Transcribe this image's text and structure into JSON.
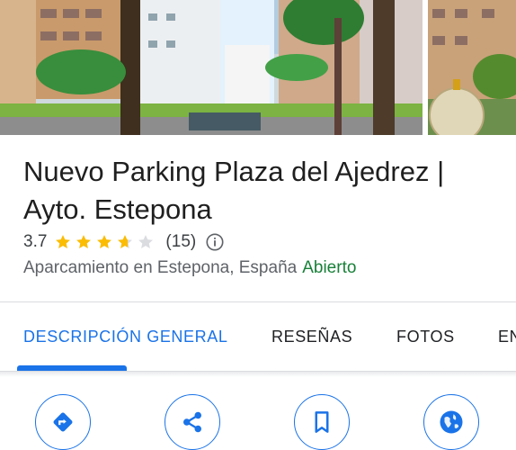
{
  "place": {
    "name": "Nuevo Parking Plaza del Ajedrez | Ayto. Estepona",
    "rating": "3.7",
    "review_count": "(15)",
    "rating_stars": 3.7,
    "category": "Aparcamiento en Estepona, España",
    "status": "Abierto"
  },
  "tabs": [
    {
      "label": "DESCRIPCIÓN GENERAL",
      "active": true
    },
    {
      "label": "RESEÑAS",
      "active": false
    },
    {
      "label": "FOTOS",
      "active": false
    },
    {
      "label": "EN",
      "active": false
    }
  ],
  "actions": [
    {
      "icon": "directions-icon"
    },
    {
      "icon": "share-icon"
    },
    {
      "icon": "bookmark-icon"
    },
    {
      "icon": "website-icon"
    }
  ],
  "colors": {
    "accent": "#1a73e8",
    "star": "#fbbc04",
    "open_status": "#188038"
  }
}
